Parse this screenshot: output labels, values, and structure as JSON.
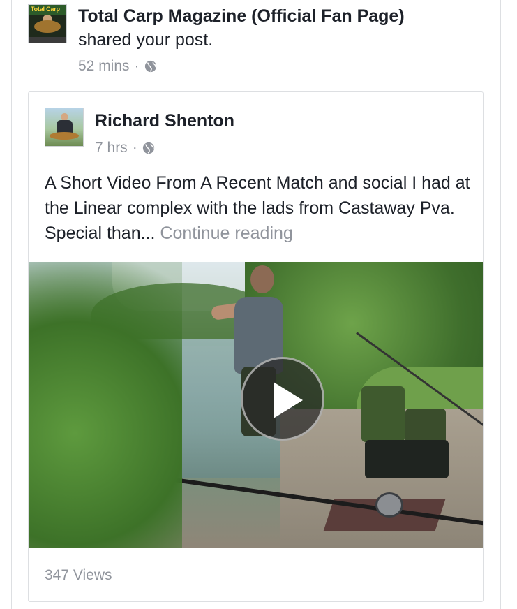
{
  "share": {
    "page_name": "Total Carp Magazine (Official Fan Page)",
    "action": "shared your post.",
    "time": "52 mins",
    "separator": "·",
    "privacy_icon": "globe-icon",
    "avatar_text": "Total Carp"
  },
  "post": {
    "author": "Richard Shenton",
    "time": "7 hrs",
    "separator": "·",
    "privacy_icon": "globe-icon",
    "text": "A Short Video From A Recent Match and social I had at the Linear complex with the lads from Castaway Pva. Special than...",
    "continue_label": "Continue reading"
  },
  "video": {
    "play_icon": "play-icon",
    "views": "347 Views"
  },
  "colors": {
    "primary_text": "#1d2129",
    "secondary_text": "#90949c",
    "border": "#dddfe2"
  }
}
